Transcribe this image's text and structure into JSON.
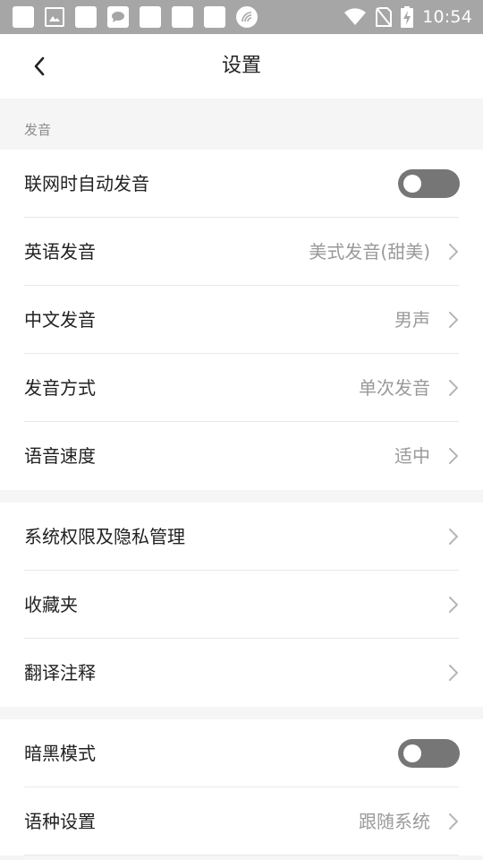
{
  "status_bar": {
    "time": "10:54",
    "icons": [
      "notification-icon",
      "photo-icon",
      "notification-icon",
      "chat-icon",
      "notification-icon",
      "notification-icon",
      "notification-icon",
      "signal-scan-icon",
      "wifi-icon",
      "no-sim-icon",
      "battery-charging-icon"
    ]
  },
  "header": {
    "title": "设置",
    "back_icon": "chevron-left-icon"
  },
  "sections": {
    "pronunciation": {
      "label": "发音",
      "rows": [
        {
          "label": "联网时自动发音",
          "type": "toggle",
          "on": false
        },
        {
          "label": "英语发音",
          "value": "美式发音(甜美)"
        },
        {
          "label": "中文发音",
          "value": "男声"
        },
        {
          "label": "发音方式",
          "value": "单次发音"
        },
        {
          "label": "语音速度",
          "value": "适中"
        }
      ]
    },
    "general": {
      "rows": [
        {
          "label": "系统权限及隐私管理"
        },
        {
          "label": "收藏夹"
        },
        {
          "label": "翻译注释"
        }
      ]
    },
    "display": {
      "rows": [
        {
          "label": "暗黑模式",
          "type": "toggle",
          "on": false
        },
        {
          "label": "语种设置",
          "value": "跟随系统"
        }
      ]
    }
  },
  "colors": {
    "status_bar": "#a6a6a6",
    "toggle_off": "#767676",
    "text_primary": "#222222",
    "text_secondary": "#9a9a9a"
  }
}
